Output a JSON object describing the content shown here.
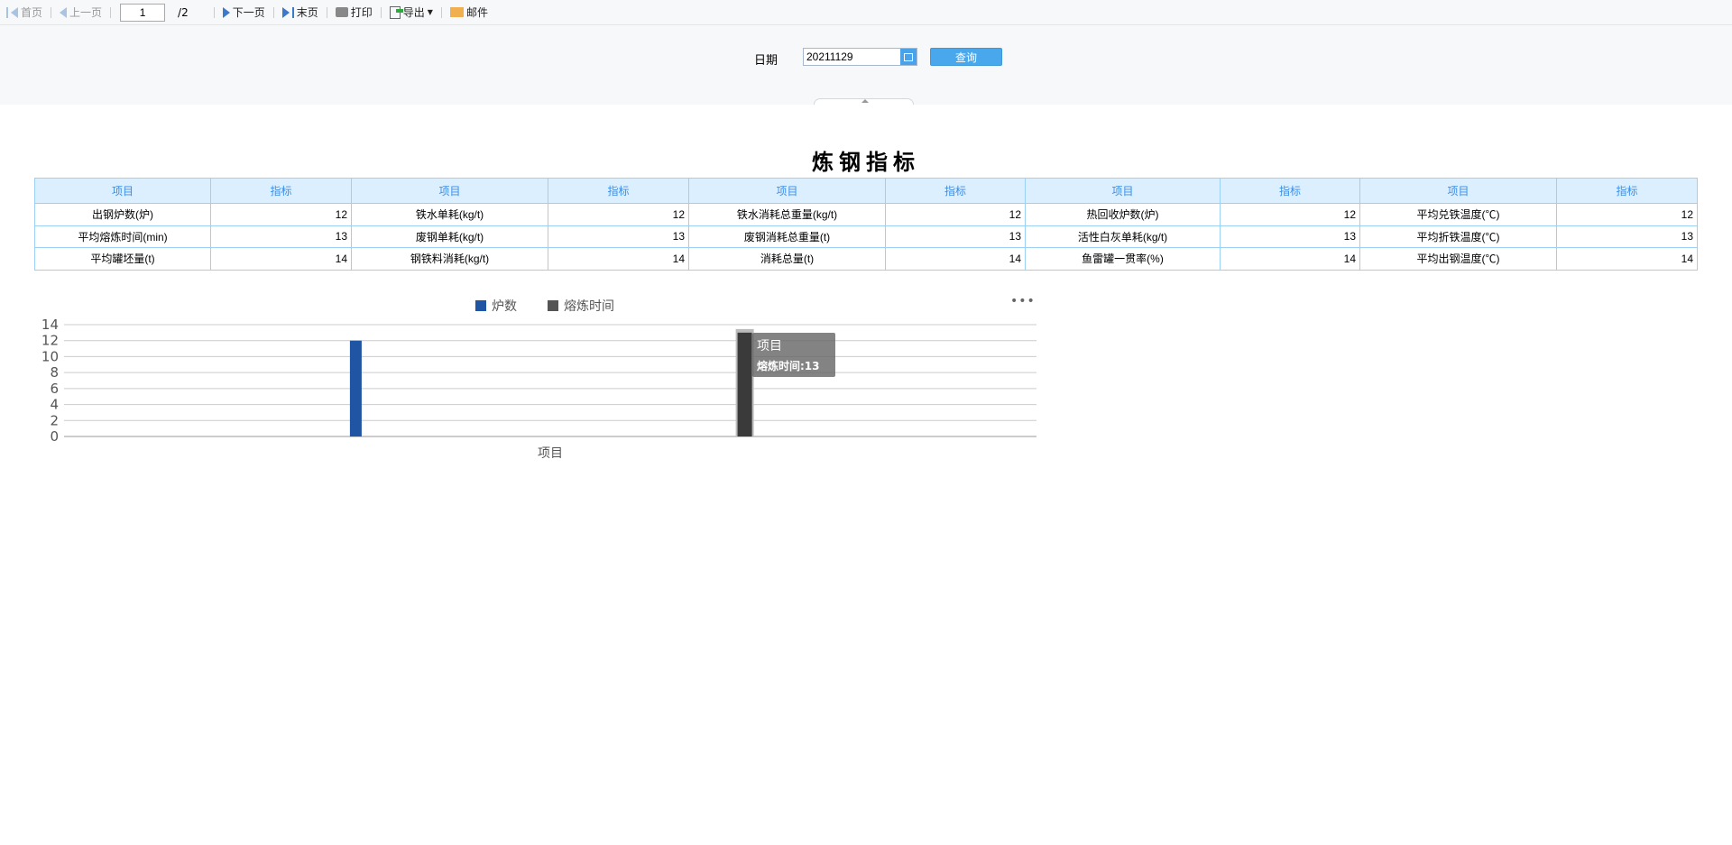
{
  "toolbar": {
    "first": "首页",
    "prev": "上一页",
    "page": "1",
    "total": "/2",
    "next": "下一页",
    "last": "末页",
    "print": "打印",
    "export": "导出",
    "mail": "邮件"
  },
  "form": {
    "date_label": "日期",
    "date_value": "20211129",
    "query": "查询"
  },
  "title": "炼钢指标",
  "table": {
    "headers": [
      "项目",
      "指标",
      "项目",
      "指标",
      "项目",
      "指标",
      "项目",
      "指标",
      "项目",
      "指标"
    ],
    "rows": [
      [
        "出钢炉数(炉)",
        "12",
        "铁水单耗(kg/t)",
        "12",
        "铁水消耗总重量(kg/t)",
        "12",
        "热回收炉数(炉)",
        "12",
        "平均兑铁温度(℃)",
        "12"
      ],
      [
        "平均熔炼时间(min)",
        "13",
        "废钢单耗(kg/t)",
        "13",
        "废钢消耗总重量(t)",
        "13",
        "活性白灰单耗(kg/t)",
        "13",
        "平均折铁温度(℃)",
        "13"
      ],
      [
        "平均罐坯量(t)",
        "14",
        "钢铁料消耗(kg/t)",
        "14",
        "消耗总量(t)",
        "14",
        "鱼雷罐一贯率(%)",
        "14",
        "平均出钢温度(℃)",
        "14"
      ]
    ]
  },
  "chart_data": {
    "type": "bar",
    "categories": [
      "项目"
    ],
    "series": [
      {
        "name": "炉数",
        "values": [
          12
        ],
        "color": "#1f55a3"
      },
      {
        "name": "熔炼时间",
        "values": [
          13
        ],
        "color": "#3a3a3a"
      }
    ],
    "legend_colors": [
      "#1f55a3",
      "#555555"
    ],
    "ylim": [
      0,
      14
    ],
    "yticks": [
      0,
      2,
      4,
      6,
      8,
      10,
      12,
      14
    ],
    "legend": "top-center",
    "grid": true
  },
  "more_label": "•••",
  "tooltip": {
    "title": "项目",
    "value": "熔炼时间:13"
  }
}
